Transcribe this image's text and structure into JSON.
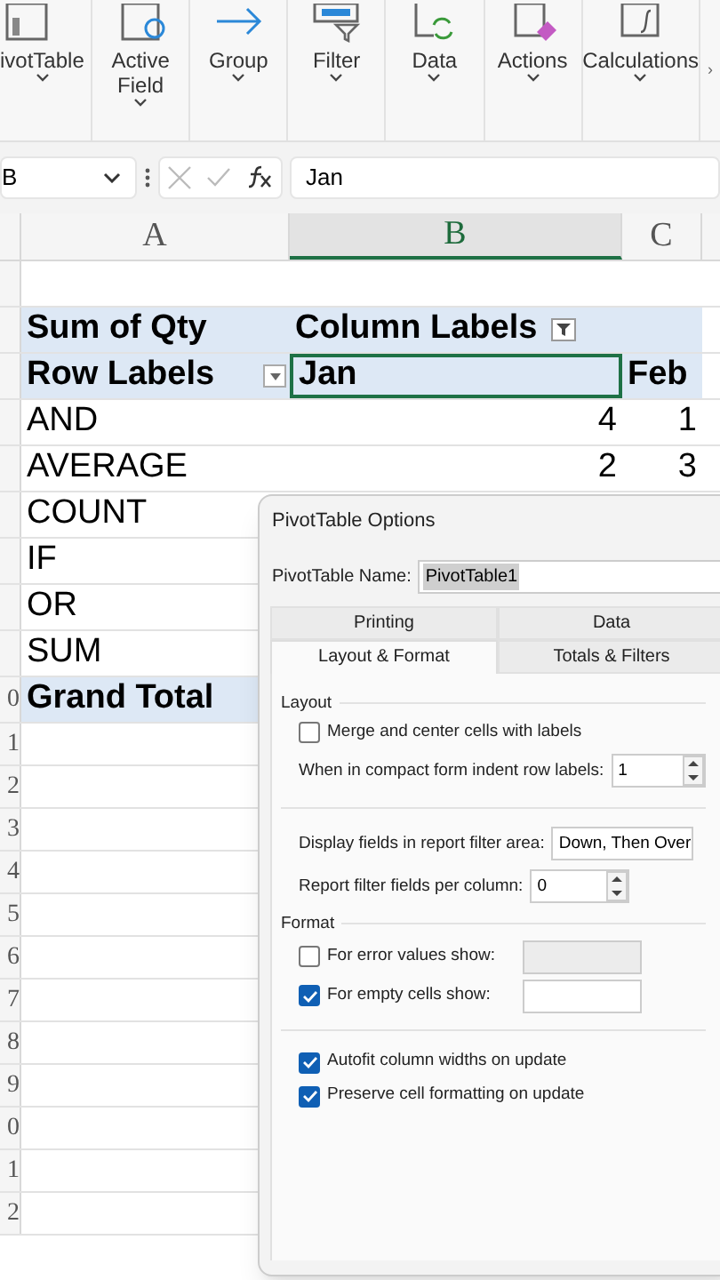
{
  "ribbon": {
    "items": [
      {
        "label": "ivotTable",
        "kind": "table"
      },
      {
        "label": "Active\nField",
        "kind": "field"
      },
      {
        "label": "Group",
        "kind": "arrow"
      },
      {
        "label": "Filter",
        "kind": "filter"
      },
      {
        "label": "Data",
        "kind": "refresh"
      },
      {
        "label": "Actions",
        "kind": "eraser"
      },
      {
        "label": "Calculations",
        "kind": "fx"
      }
    ],
    "more": "›"
  },
  "formula_bar": {
    "name_box": "B",
    "value": "Jan"
  },
  "columns": [
    {
      "label": "A",
      "selected": false
    },
    {
      "label": "B",
      "selected": true
    },
    {
      "label": "C",
      "selected": false
    }
  ],
  "row_numbers": [
    "0",
    "1",
    "2",
    "3",
    "4",
    "5",
    "6",
    "7",
    "8",
    "9",
    "0",
    "1",
    "2"
  ],
  "pivot": {
    "header": [
      "Sum of Qty",
      "Column Labels"
    ],
    "row_labels": "Row Labels",
    "col_items": [
      {
        "label": "Jan",
        "selected": true
      },
      {
        "label": "Feb",
        "selected": false
      }
    ],
    "rows": [
      {
        "label": "AND",
        "values": [
          "4",
          "1"
        ]
      },
      {
        "label": "AVERAGE",
        "values": [
          "2",
          "3"
        ]
      },
      {
        "label": "COUNT",
        "values": []
      },
      {
        "label": "IF",
        "values": []
      },
      {
        "label": "OR",
        "values": []
      },
      {
        "label": "SUM",
        "values": []
      }
    ],
    "total": "Grand Total"
  },
  "dialog": {
    "title": "PivotTable Options",
    "name_label": "PivotTable Name:",
    "name_value": "PivotTable1",
    "tabs": [
      [
        {
          "label": "Printing",
          "selected": false
        },
        {
          "label": "Data",
          "selected": false
        }
      ],
      [
        {
          "label": "Layout & Format",
          "selected": true
        },
        {
          "label": "Totals & Filters",
          "selected": false
        }
      ]
    ],
    "sections": [
      {
        "title": "Layout",
        "items": [
          {
            "kind": "checkbox",
            "label": "Merge and center cells with labels",
            "checked": false
          },
          {
            "kind": "spinner",
            "label": "When in compact form indent row labels:",
            "value": "1"
          },
          {
            "kind": "divider"
          },
          {
            "kind": "dropdown",
            "label": "Display fields in report filter area:",
            "value": "Down, Then Over"
          },
          {
            "kind": "spinner",
            "label": "Report filter fields per column:",
            "value": "0"
          }
        ]
      },
      {
        "title": "Format",
        "items": [
          {
            "kind": "checkfield",
            "label": "For error values show:",
            "checked": false
          },
          {
            "kind": "checkfield",
            "label": "For empty cells show:",
            "checked": true
          },
          {
            "kind": "divider"
          },
          {
            "kind": "checkbox",
            "label": "Autofit column widths on update",
            "checked": true
          },
          {
            "kind": "checkbox",
            "label": "Preserve cell formatting on update",
            "checked": true
          }
        ]
      }
    ]
  }
}
